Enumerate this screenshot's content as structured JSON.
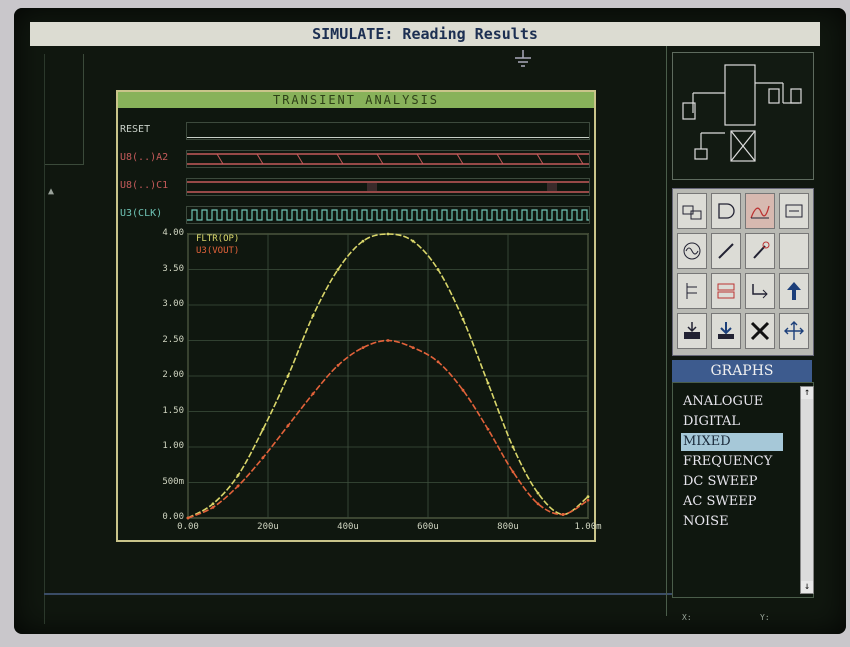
{
  "window": {
    "title": "SIMULATE: Reading Results"
  },
  "graph": {
    "title": "TRANSIENT ANALYSIS",
    "digital_traces": [
      {
        "label": "RESET",
        "color": "#c8d0c8"
      },
      {
        "label": "U8(..)A2",
        "color": "#c45a5a"
      },
      {
        "label": "U8(..)C1",
        "color": "#c45a5a"
      },
      {
        "label": "U3(CLK)",
        "color": "#6fc3b5"
      }
    ],
    "legend": [
      {
        "label": "FLTR(OP)",
        "color": "#d9d66a"
      },
      {
        "label": "U3(VOUT)",
        "color": "#e2623a"
      }
    ]
  },
  "chart_data": {
    "type": "line",
    "title": "TRANSIENT ANALYSIS",
    "x": [
      0,
      50,
      100,
      150,
      200,
      250,
      300,
      350,
      400,
      450,
      500,
      550,
      600,
      650,
      700,
      750,
      800
    ],
    "xlim": [
      0,
      800
    ],
    "ylim": [
      0,
      4.0
    ],
    "xticks": [
      "0.00",
      "200u",
      "400u",
      "600u",
      "800u",
      "1.00m"
    ],
    "yticks": [
      "0.00",
      "500m",
      "1.00",
      "1.50",
      "2.00",
      "2.50",
      "3.00",
      "3.50",
      "4.00"
    ],
    "series": [
      {
        "name": "FLTR(OP)",
        "color": "#d9d66a",
        "values": [
          0.0,
          0.2,
          0.6,
          1.25,
          2.0,
          2.85,
          3.5,
          3.9,
          4.0,
          3.9,
          3.5,
          2.8,
          1.9,
          1.0,
          0.35,
          0.05,
          0.3
        ]
      },
      {
        "name": "U3(VOUT)",
        "color": "#e2623a",
        "values": [
          0.0,
          0.15,
          0.45,
          0.85,
          1.3,
          1.75,
          2.15,
          2.4,
          2.5,
          2.4,
          2.2,
          1.8,
          1.25,
          0.65,
          0.2,
          0.05,
          0.25
        ]
      }
    ],
    "grid": true
  },
  "toolbar": {
    "icons": [
      "digital-component-icon",
      "and-gate-icon",
      "graph-icon",
      "file-icon",
      "sine-generator-icon",
      "probe-pen-icon",
      "voltage-probe-icon",
      "empty-tool-icon",
      "pin-list-icon",
      "terminals-icon",
      "wire-route-icon",
      "arrow-up-icon",
      "import-icon",
      "download-icon",
      "delete-x-icon",
      "resize-arrows-icon"
    ]
  },
  "graphs_panel": {
    "header": "GRAPHS",
    "items": [
      "ANALOGUE",
      "DIGITAL",
      "MIXED",
      "FREQUENCY",
      "DC SWEEP",
      "AC SWEEP",
      "NOISE"
    ],
    "selected": "MIXED"
  },
  "status": {
    "left": "X:",
    "right": "Y:"
  }
}
